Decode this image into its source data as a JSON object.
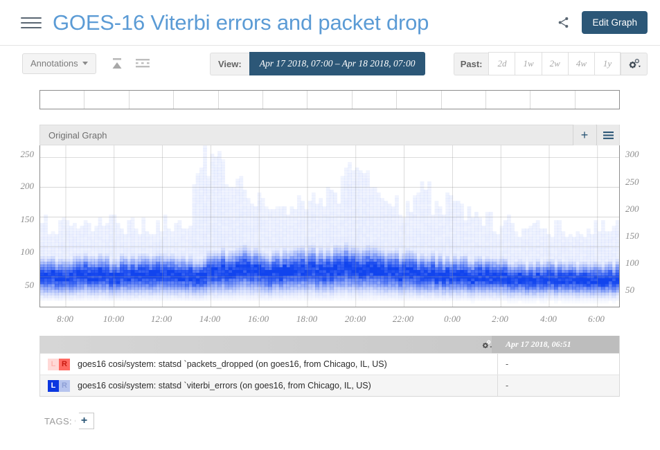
{
  "header": {
    "menu_icon": "hamburger-icon",
    "title": "GOES-16 Viterbi errors and packet drop",
    "share_icon": "share-icon",
    "edit_button": "Edit Graph"
  },
  "toolbar": {
    "annotations_label": "Annotations",
    "annotations_caret": "caret-down-icon",
    "icon1": "collapse-up-icon",
    "icon2": "stacked-lines-icon",
    "view_label": "View:",
    "view_range": "Apr 17 2018, 07:00  –  Apr 18 2018, 07:00",
    "past_label": "Past:",
    "past_options": [
      "2d",
      "1w",
      "2w",
      "4w",
      "1y"
    ],
    "settings_icon": "gear-icon"
  },
  "annotation_strip": {
    "cells": 13
  },
  "panel": {
    "title": "Original Graph",
    "add_icon": "plus-icon",
    "menu_icon": "hamburger-menu-icon"
  },
  "chart_data": {
    "type": "heatmap",
    "title": "Original Graph",
    "xlabel": "",
    "ylabel": "",
    "grid": true,
    "legend_position": "below",
    "x_axis": {
      "ticks": [
        "8:00",
        "10:00",
        "12:00",
        "14:00",
        "16:00",
        "18:00",
        "20:00",
        "22:00",
        "0:00",
        "2:00",
        "4:00",
        "6:00"
      ],
      "range_start": "Apr 17 2018, 07:00",
      "range_end": "Apr 18 2018, 07:00"
    },
    "y_left": {
      "ticks": [
        50,
        100,
        150,
        200,
        250
      ],
      "ylim": [
        0,
        270
      ],
      "series": "viterbi_errors",
      "color": "#1144ee"
    },
    "y_right": {
      "ticks": [
        50,
        100,
        150,
        200,
        250,
        300
      ],
      "ylim": [
        0,
        320
      ],
      "series": "packets_dropped",
      "color": "#ff3b30"
    },
    "description": "Density histogram heatmap of viterbi_errors; dense blue band centred near 50 with light-blue tail extending to ~140 and transient spikes up to ~250 around 14:30-15:30 and ~20:00.",
    "series": [
      {
        "name": "viterbi_errors",
        "axis": "left",
        "color": "#1144ee",
        "median": [
          52,
          51,
          50,
          52,
          53,
          51,
          50,
          52,
          51,
          53,
          52,
          51,
          50,
          52,
          54,
          58,
          62,
          60,
          57,
          55,
          58,
          62,
          60,
          58,
          62,
          66,
          63,
          60,
          58,
          56,
          55,
          54,
          53,
          52,
          51,
          50,
          49,
          48,
          47,
          46,
          45,
          46,
          47,
          46,
          45,
          44,
          45,
          46
        ],
        "p90": [
          138,
          136,
          140,
          135,
          137,
          134,
          139,
          136,
          138,
          133,
          140,
          137,
          135,
          250,
          248,
          230,
          210,
          175,
          172,
          173,
          174,
          176,
          178,
          182,
          190,
          215,
          250,
          195,
          165,
          168,
          160,
          200,
          175,
          170,
          165,
          150,
          145,
          140,
          135,
          130,
          132,
          128,
          130,
          133,
          135,
          131,
          129,
          134
        ]
      },
      {
        "name": "packets_dropped",
        "axis": "right",
        "color": "#ff3b30",
        "median": [],
        "p90": []
      }
    ]
  },
  "legend": {
    "settings_icon": "gear-icon",
    "timestamp_header": "Apr 17 2018, 06:51",
    "rows": [
      {
        "axis_left": "L",
        "axis_right": "R",
        "active_axis": "R",
        "color": "#ff3b30",
        "color_faded": "#ffd9d7",
        "label": "goes16 cosi/system: statsd `packets_dropped (on goes16, from Chicago, IL, US)",
        "value": "-"
      },
      {
        "axis_left": "L",
        "axis_right": "R",
        "active_axis": "L",
        "color": "#0b37e0",
        "color_faded": "#b6c4ee",
        "label": "goes16 cosi/system: statsd `viterbi_errors (on goes16, from Chicago, IL, US)",
        "value": "-"
      }
    ]
  },
  "tags": {
    "label": "TAGS:",
    "add_icon": "plus-icon"
  }
}
